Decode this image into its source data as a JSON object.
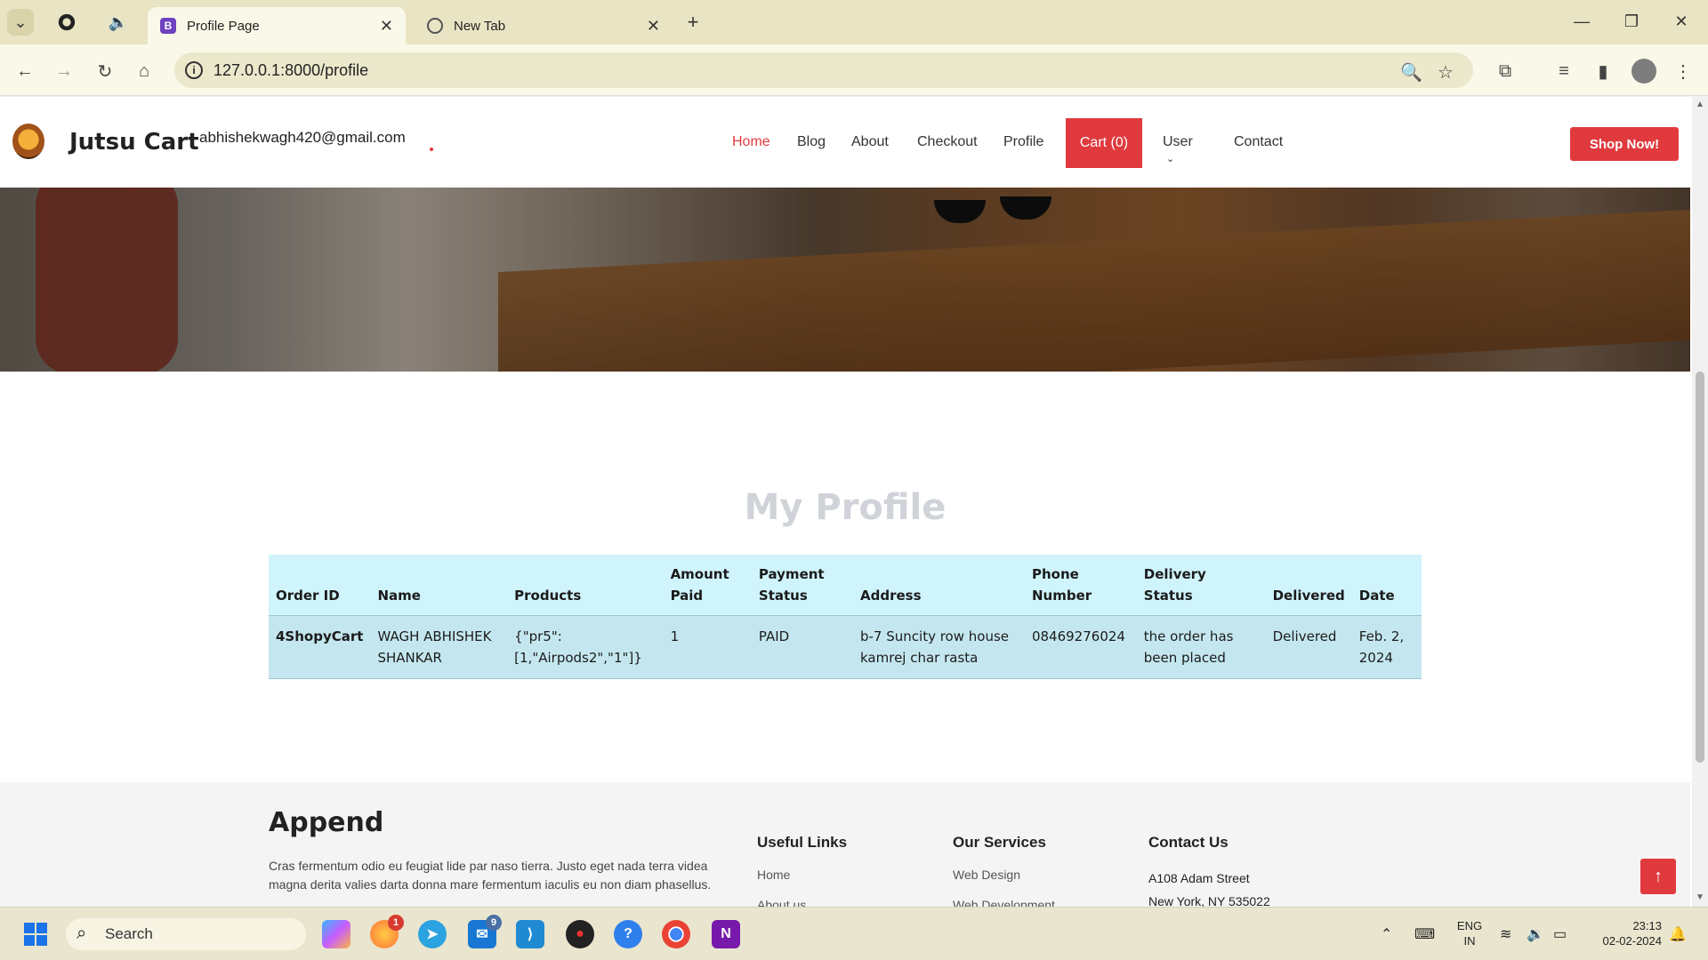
{
  "browser": {
    "tabs": [
      {
        "title": "Profile Page",
        "favicon": "bootstrap-icon",
        "active": true
      },
      {
        "title": "New Tab",
        "favicon": "chrome-icon",
        "active": false
      }
    ],
    "url": "127.0.0.1:8000/profile"
  },
  "site": {
    "brand": "Jutsu Cart",
    "email": "abhishekwagh420@gmail.com",
    "nav": {
      "home": "Home",
      "blog": "Blog",
      "about": "About",
      "checkout": "Checkout",
      "profile": "Profile",
      "cart": "Cart (0)",
      "user": "User",
      "contact": "Contact"
    },
    "shop_now": "Shop Now!",
    "accent_color": "#e03a3e"
  },
  "profile": {
    "title": "My Profile",
    "columns": [
      "Order ID",
      "Name",
      "Products",
      "Amount Paid",
      "Payment Status",
      "Address",
      "Phone Number",
      "Delivery Status",
      "Delivered",
      "Date"
    ],
    "orders": [
      {
        "order_id": "4ShopyCart",
        "name": "WAGH ABHISHEK SHANKAR",
        "products": "{\"pr5\": [1,\"Airpods2\",\"1\"]}",
        "amount_paid": "1",
        "payment_status": "PAID",
        "address": "b-7 Suncity row house kamrej char rasta",
        "phone": "08469276024",
        "delivery_status": "the order has been placed",
        "delivered": "Delivered",
        "date": "Feb. 2, 2024"
      }
    ]
  },
  "footer": {
    "brand": "Append",
    "description": "Cras fermentum odio eu feugiat lide par naso tierra. Justo eget nada terra videa magna derita valies darta donna mare fermentum iaculis eu non diam phasellus.",
    "useful_links": {
      "heading": "Useful Links",
      "items": [
        "Home",
        "About us"
      ]
    },
    "services": {
      "heading": "Our Services",
      "items": [
        "Web Design",
        "Web Development"
      ]
    },
    "contact": {
      "heading": "Contact Us",
      "lines": [
        "A108 Adam Street",
        "New York, NY 535022"
      ]
    }
  },
  "taskbar": {
    "search_placeholder": "Search",
    "badges": {
      "firefox": "1",
      "mail": "9"
    },
    "lang": "ENG",
    "region": "IN",
    "time": "23:13",
    "date": "02-02-2024"
  }
}
